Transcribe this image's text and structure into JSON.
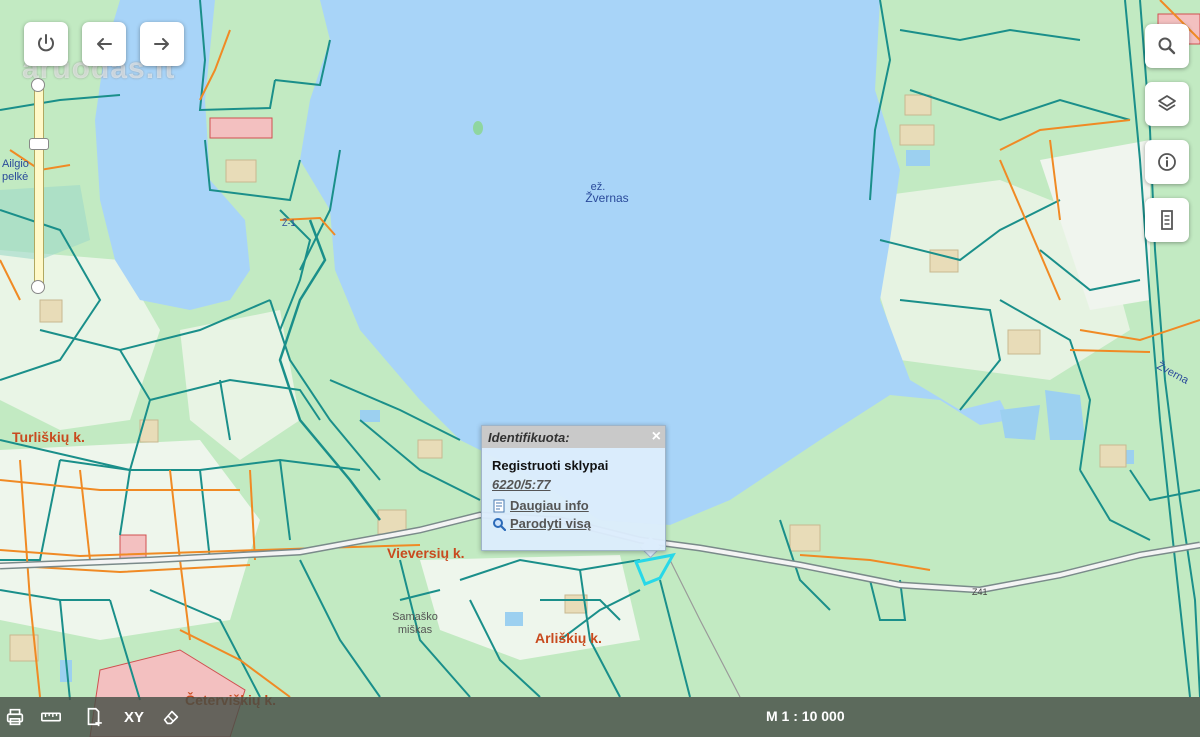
{
  "watermark": "aruodas.lt",
  "map_labels": {
    "lake_prefix": "ež.",
    "lake_name": "Žvernas",
    "west_label_1": "Ailgio",
    "west_label_2": "pelkė",
    "road_label_1": "Ž-1",
    "road_label_2": "Z41",
    "east_label": "Žverna",
    "village_turliskiu": "Turliškių k.",
    "village_vieversiu": "Vieversių k.",
    "village_arliskiu": "Arliškių k.",
    "village_ceterviskiu": "Četerviškių k.",
    "forest_1": "Samaško",
    "forest_2": "miškas"
  },
  "popup": {
    "header": "Identifikuota:",
    "close": "×",
    "title": "Registruoti sklypai",
    "parcel_id": "6220/5:77",
    "more_info": "Daugiau info",
    "show_all": "Parodyti visą"
  },
  "bottom_bar": {
    "xy": "XY",
    "scale": "M 1 : 10 000"
  },
  "colors": {
    "water": "#a8d4f8",
    "land": "#bfe8c0",
    "parcel_border": "#1a8f8a",
    "road": "#f08a24",
    "highlight": "#28d8e8",
    "label_village": "#c84a1e"
  },
  "icons": {
    "power": "power-icon",
    "back": "back-arrow-icon",
    "forward": "forward-arrow-icon",
    "search": "search-icon",
    "layers": "layers-icon",
    "info": "info-icon",
    "legend": "document-icon",
    "print": "printer-icon",
    "measure": "ruler-icon",
    "add": "add-document-icon",
    "erase": "eraser-icon"
  }
}
